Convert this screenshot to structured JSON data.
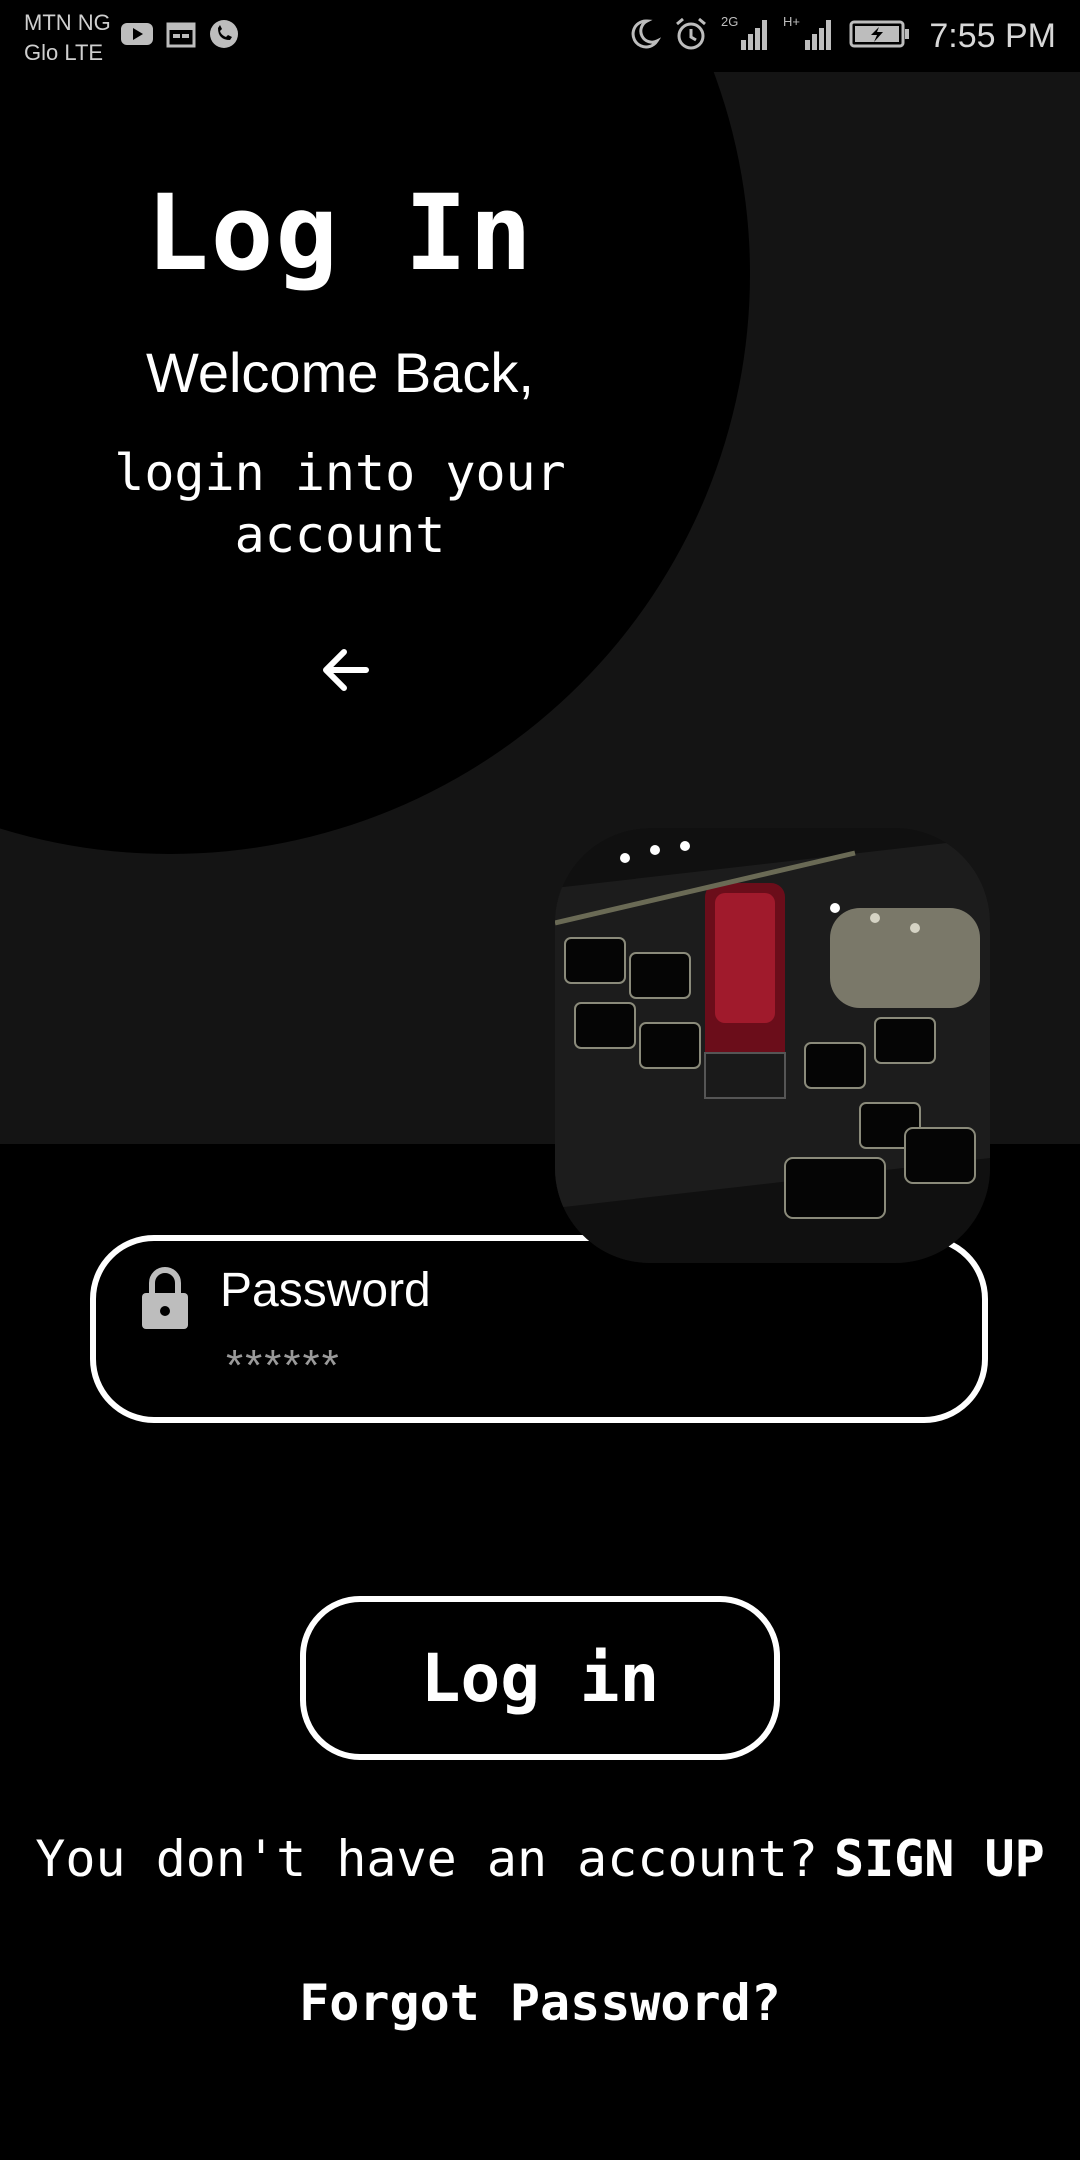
{
  "status_bar": {
    "carrier_line1": "MTN NG",
    "carrier_line2": "Glo LTE",
    "time": "7:55 PM",
    "icons_left": [
      "youtube-icon",
      "calendar-icon",
      "phone-call-icon"
    ],
    "icons_right": [
      "moon-icon",
      "alarm-icon",
      "signal-2g-icon",
      "signal-hplus-icon",
      "battery-charging-icon"
    ],
    "network_1": "2G",
    "network_2": "H+"
  },
  "header": {
    "title": "Log In",
    "welcome": "Welcome Back,",
    "subtitle": "login into your account"
  },
  "password": {
    "label": "Password",
    "value": "******"
  },
  "actions": {
    "login_label": "Log in",
    "signup_prompt": "You don't have an account?",
    "signup_link": "SIGN UP",
    "forgot_password": "Forgot Password?"
  },
  "colors": {
    "background": "#000000",
    "top_section": "#141414",
    "text": "#ffffff",
    "placeholder": "#9a9a9a"
  }
}
